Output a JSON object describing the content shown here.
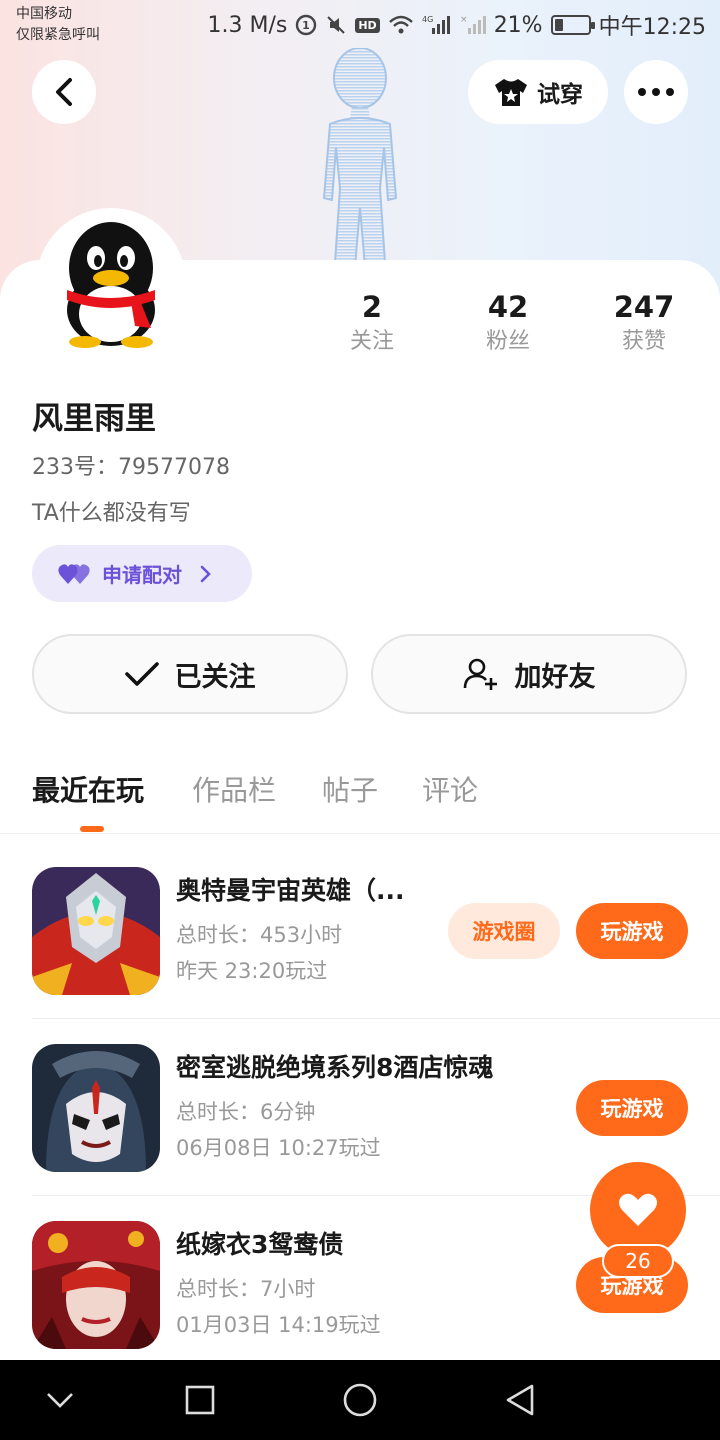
{
  "status_bar": {
    "carrier": "中国移动",
    "emergency": "仅限紧急呼叫",
    "speed": "1.3 M/s",
    "hd": "HD",
    "network": "4G",
    "battery": "21%",
    "time": "中午12:25"
  },
  "header": {
    "try_on_label": "试穿"
  },
  "profile": {
    "stats": [
      {
        "value": "2",
        "label": "关注"
      },
      {
        "value": "42",
        "label": "粉丝"
      },
      {
        "value": "247",
        "label": "获赞"
      }
    ],
    "nickname": "风里雨里",
    "uid": "233号：79577078",
    "bio": "TA什么都没有写",
    "pair_label": "申请配对",
    "follow_label": "已关注",
    "add_friend_label": "加好友"
  },
  "tabs": [
    {
      "label": "最近在玩",
      "active": true
    },
    {
      "label": "作品栏",
      "active": false
    },
    {
      "label": "帖子",
      "active": false
    },
    {
      "label": "评论",
      "active": false
    }
  ],
  "games": [
    {
      "title": "奥特曼宇宙英雄（...",
      "duration": "总时长：453小时",
      "last_played": "昨天 23:20玩过",
      "circle_label": "游戏圈",
      "play_label": "玩游戏"
    },
    {
      "title": "密室逃脱绝境系列8酒店惊魂",
      "duration": "总时长：6分钟",
      "last_played": "06月08日 10:27玩过",
      "play_label": "玩游戏"
    },
    {
      "title": "纸嫁衣3鸳鸯债",
      "duration": "总时长：7小时",
      "last_played": "01月03日 14:19玩过",
      "play_label": "玩游戏"
    }
  ],
  "like": {
    "count": "26"
  },
  "colors": {
    "accent": "#ff6a1a",
    "pair": "#6b52d8"
  }
}
